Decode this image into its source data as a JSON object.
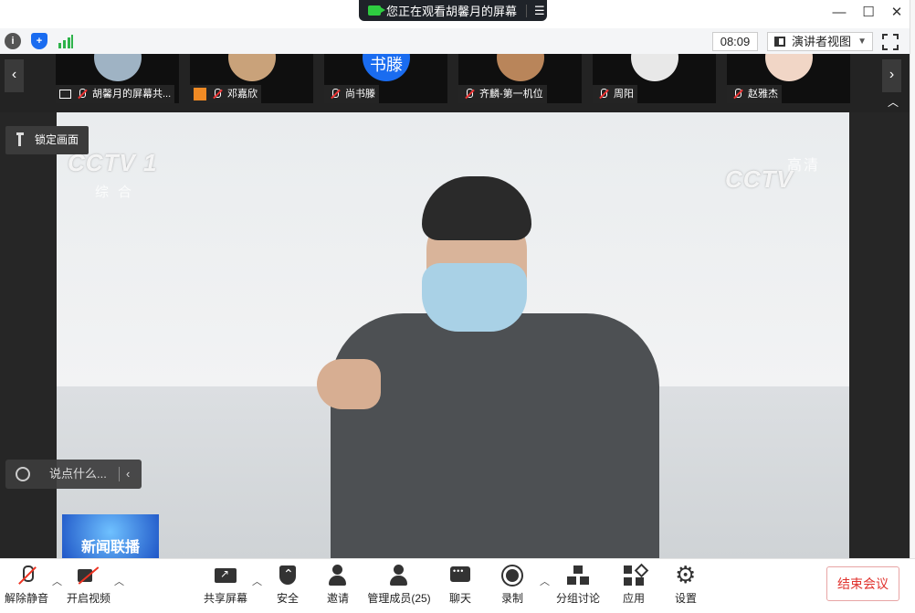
{
  "window": {
    "share_banner": "您正在观看胡馨月的屏幕",
    "share_menu_icon": "menu-lines-icon",
    "controls": {
      "minimize": "—",
      "maximize": "☐",
      "close": "✕"
    }
  },
  "infobar": {
    "icons": [
      "info-icon",
      "shield-icon",
      "signal-icon"
    ],
    "time": "08:09",
    "view_mode": "演讲者视图",
    "fullscreen_icon": "fullscreen-icon"
  },
  "participants": [
    {
      "name": "胡馨月的屏幕共...",
      "avatar": ""
    },
    {
      "name": "邓嘉欣",
      "avatar": ""
    },
    {
      "name": "尚书滕",
      "avatar": "书滕"
    },
    {
      "name": "齐麟-第一机位",
      "avatar": ""
    },
    {
      "name": "周阳",
      "avatar": ""
    },
    {
      "name": "赵雅杰",
      "avatar": ""
    }
  ],
  "stage": {
    "pin_label": "锁定画面",
    "chat_placeholder": "说点什么...",
    "watermark_left": "CCTV",
    "watermark_left_num": "1",
    "watermark_left_sub": "综合",
    "watermark_right": "CCTV",
    "watermark_right_extra": "高清",
    "news_logo": "新闻联播"
  },
  "toolbar": {
    "mute": "解除静音",
    "video": "开启视频",
    "share": "共享屏幕",
    "security": "安全",
    "invite": "邀请",
    "members": "管理成员(25)",
    "chat": "聊天",
    "record": "录制",
    "breakout": "分组讨论",
    "apps": "应用",
    "settings": "设置",
    "end": "结束会议"
  },
  "colors": {
    "accent_red": "#e0322d",
    "banner_bg": "#1f2329",
    "strip_bg": "#232323",
    "avatar_blue": "#1a6cf0"
  }
}
